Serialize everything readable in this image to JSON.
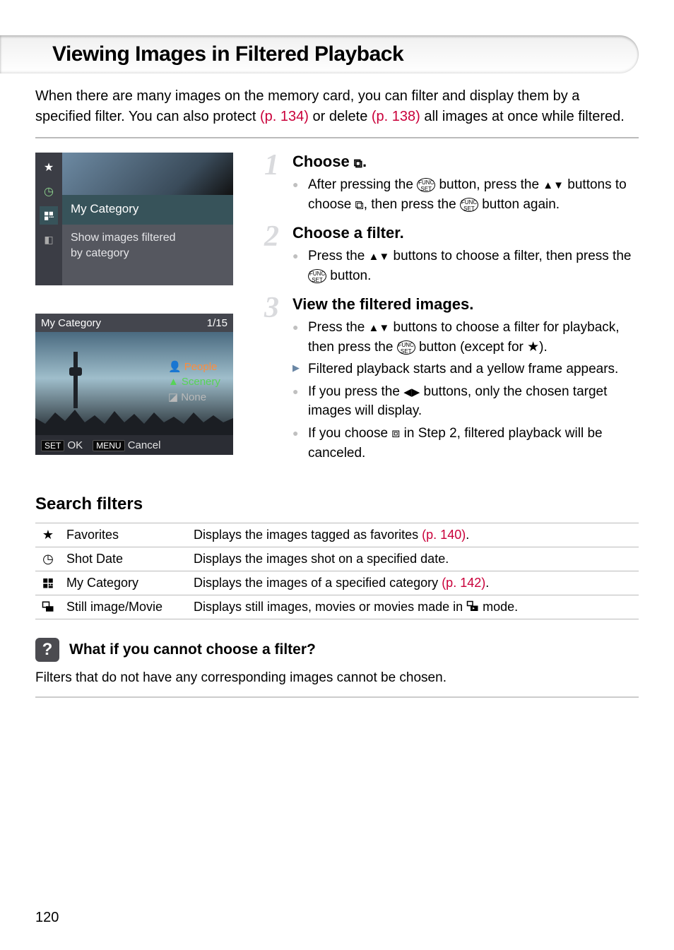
{
  "title": "Viewing Images in Filtered Playback",
  "intro": {
    "part1": "When there are many images on the memory card, you can filter and display them by a specified filter. You can also protect ",
    "p_link": "(p. 134)",
    "part2": " or delete ",
    "d_link": "(p. 138)",
    "part3": " all images at once while filtered."
  },
  "shot1": {
    "selected": "My Category",
    "desc1": "Show images filtered",
    "desc2": "by category"
  },
  "shot2": {
    "header_left": "My Category",
    "header_right": "1/15",
    "tag1": "People",
    "tag2": "Scenery",
    "tag3": "None",
    "ok": "OK",
    "cancel": "Cancel",
    "set": "SET",
    "menu": "MENU"
  },
  "steps": [
    {
      "num": "1",
      "heading_prefix": "Choose ",
      "heading_suffix": ".",
      "items": [
        {
          "t": "bullet",
          "parts": [
            "After pressing the ",
            " button, press the ",
            " buttons to choose ",
            ", then press the ",
            " button again."
          ]
        }
      ]
    },
    {
      "num": "2",
      "heading": "Choose a filter.",
      "items": [
        {
          "t": "bullet",
          "parts": [
            "Press the ",
            " buttons to choose a filter, then press the ",
            " button."
          ]
        }
      ]
    },
    {
      "num": "3",
      "heading": "View the filtered images.",
      "items": [
        {
          "t": "bullet",
          "parts": [
            "Press the ",
            " buttons to choose a filter for playback, then press the ",
            " button (except for ",
            ")."
          ]
        },
        {
          "t": "arrow",
          "text": "Filtered playback starts and a yellow frame appears."
        },
        {
          "t": "bullet",
          "parts": [
            "If you press the ",
            " buttons, only the chosen target images will display."
          ]
        },
        {
          "t": "bullet",
          "parts": [
            "If you choose ",
            " in Step 2, filtered playback will be canceled."
          ]
        }
      ]
    }
  ],
  "search_heading": "Search filters",
  "filters_table": [
    {
      "icon": "star",
      "name": "Favorites",
      "desc_pre": "Displays the images tagged as favorites ",
      "desc_link": "(p. 140)",
      "desc_post": "."
    },
    {
      "icon": "clock",
      "name": "Shot Date",
      "desc_pre": "Displays the images shot on a specified date.",
      "desc_link": "",
      "desc_post": ""
    },
    {
      "icon": "book",
      "name": "My Category",
      "desc_pre": "Displays the images of a specified category ",
      "desc_link": "(p. 142)",
      "desc_post": "."
    },
    {
      "icon": "movie",
      "name": "Still image/Movie",
      "desc_pre": "Displays still images, movies or movies made in ",
      "desc_icon": "digest",
      "desc_post": " mode."
    }
  ],
  "callout": {
    "title": "What if you cannot choose a filter?",
    "body": "Filters that do not have any corresponding images cannot be chosen."
  },
  "page_number": "120"
}
